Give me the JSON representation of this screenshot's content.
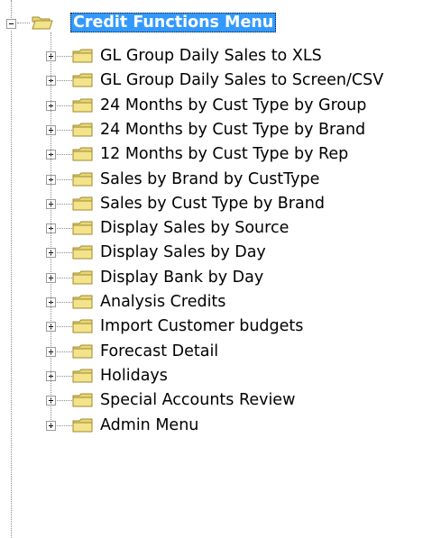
{
  "tree": {
    "root": {
      "label": "Credit Functions Menu",
      "icon": "folder-open-icon",
      "expanded": true,
      "selected": true
    },
    "children": [
      {
        "label": "GL Group Daily Sales to XLS",
        "icon": "folder-icon"
      },
      {
        "label": "GL Group Daily Sales to Screen/CSV",
        "icon": "folder-icon"
      },
      {
        "label": "24 Months by Cust Type by Group",
        "icon": "folder-icon"
      },
      {
        "label": "24 Months by Cust Type by Brand",
        "icon": "folder-icon"
      },
      {
        "label": "12 Months by Cust Type by Rep",
        "icon": "folder-icon"
      },
      {
        "label": "Sales by Brand by CustType",
        "icon": "folder-icon"
      },
      {
        "label": "Sales by Cust Type by Brand",
        "icon": "folder-icon"
      },
      {
        "label": "Display Sales by Source",
        "icon": "folder-icon"
      },
      {
        "label": "Display Sales by Day",
        "icon": "folder-icon"
      },
      {
        "label": "Display Bank by Day",
        "icon": "folder-icon"
      },
      {
        "label": "Analysis Credits",
        "icon": "folder-icon"
      },
      {
        "label": "Import Customer budgets",
        "icon": "folder-icon"
      },
      {
        "label": "Forecast Detail",
        "icon": "folder-icon"
      },
      {
        "label": "Holidays",
        "icon": "folder-icon"
      },
      {
        "label": "Special Accounts Review",
        "icon": "folder-icon"
      },
      {
        "label": "Admin Menu",
        "icon": "folder-icon"
      }
    ]
  },
  "colors": {
    "selection": "#3399ff",
    "folder_fill": "#f3e38a",
    "folder_stroke": "#a08a30"
  }
}
